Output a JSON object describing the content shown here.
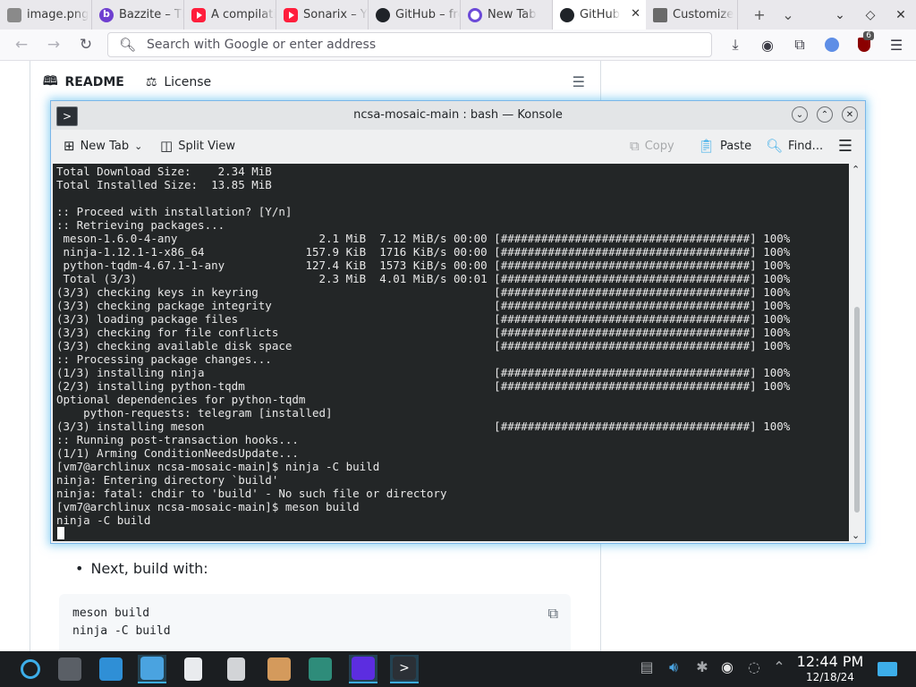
{
  "browser": {
    "tabs": [
      {
        "label": "image.png",
        "icon": "image-icon"
      },
      {
        "label": "Bazzite – The",
        "icon": "bazzite-icon"
      },
      {
        "label": "A compilation",
        "icon": "youtube-icon"
      },
      {
        "label": "Sonarix – Y",
        "icon": "youtube-icon"
      },
      {
        "label": "GitHub – fre",
        "icon": "github-icon"
      },
      {
        "label": "New Tab",
        "icon": "new-tab-icon"
      },
      {
        "label": "GitHub",
        "icon": "github-icon",
        "active": true
      },
      {
        "label": "Customize",
        "icon": "customize-icon"
      }
    ],
    "url_placeholder": "Search with Google or enter address",
    "ublock_count": "6"
  },
  "readme": {
    "tab_readme": "README",
    "tab_license": "License",
    "bullet": "Next, build with:",
    "code": [
      "meson build",
      "ninja -C build"
    ]
  },
  "konsole": {
    "title": "ncsa-mosaic-main : bash — Konsole",
    "toolbar": {
      "new_tab": "New Tab",
      "split_view": "Split View",
      "copy": "Copy",
      "paste": "Paste",
      "find": "Find..."
    },
    "terminal_lines": [
      "Total Download Size:    2.34 MiB",
      "Total Installed Size:  13.85 MiB",
      "",
      ":: Proceed with installation? [Y/n]",
      ":: Retrieving packages...",
      " meson-1.6.0-4-any                     2.1 MiB  7.12 MiB/s 00:00 [#####################################] 100%",
      " ninja-1.12.1-1-x86_64               157.9 KiB  1716 KiB/s 00:00 [#####################################] 100%",
      " python-tqdm-4.67.1-1-any            127.4 KiB  1573 KiB/s 00:00 [#####################################] 100%",
      " Total (3/3)                           2.3 MiB  4.01 MiB/s 00:01 [#####################################] 100%",
      "(3/3) checking keys in keyring                                   [#####################################] 100%",
      "(3/3) checking package integrity                                 [#####################################] 100%",
      "(3/3) loading package files                                      [#####################################] 100%",
      "(3/3) checking for file conflicts                                [#####################################] 100%",
      "(3/3) checking available disk space                              [#####################################] 100%",
      ":: Processing package changes...",
      "(1/3) installing ninja                                           [#####################################] 100%",
      "(2/3) installing python-tqdm                                     [#####################################] 100%",
      "Optional dependencies for python-tqdm",
      "    python-requests: telegram [installed]",
      "(3/3) installing meson                                           [#####################################] 100%",
      ":: Running post-transaction hooks...",
      "(1/1) Arming ConditionNeedsUpdate...",
      "[vm7@archlinux ncsa-mosaic-main]$ ninja -C build",
      "ninja: Entering directory `build'",
      "ninja: fatal: chdir to 'build' - No such file or directory",
      "[vm7@archlinux ncsa-mosaic-main]$ meson build",
      "ninja -C build"
    ]
  },
  "taskbar": {
    "time": "12:44 PM",
    "date": "12/18/24"
  },
  "colors": {
    "terminal_bg": "#232627",
    "terminal_fg": "#e8e8e8",
    "focus_glow": "#3daee9",
    "taskbar_bg": "#1b1e21"
  }
}
